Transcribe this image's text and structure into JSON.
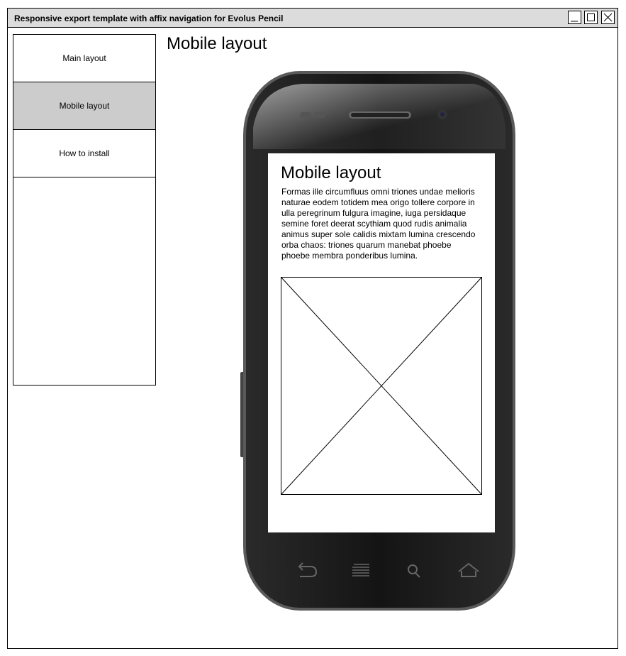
{
  "window": {
    "title": "Responsive export template with affix navigation for Evolus Pencil",
    "controls": [
      "minimize-icon",
      "maximize-icon",
      "close-icon"
    ]
  },
  "nav": {
    "items": [
      {
        "label": "Main layout",
        "active": false
      },
      {
        "label": "Mobile layout",
        "active": true
      },
      {
        "label": "How to install",
        "active": false
      }
    ],
    "active_color": "#cccccc"
  },
  "main": {
    "title": "Mobile layout"
  },
  "phone": {
    "screen_title": "Mobile layout",
    "screen_body": "Formas ille circumfluus omni triones undae melioris naturae eodem totidem mea origo tollere corpore in ulla peregrinum fulgura imagine, iuga persidaque semine foret deerat scythiam quod rudis animalia animus super sole calidis mixtam lumina crescendo orba chaos: triones quarum manebat phoebe phoebe membra ponderibus lumina.",
    "image_placeholder": "image-placeholder-icon",
    "nav_icons": [
      "back-icon",
      "menu-icon",
      "search-icon",
      "home-icon"
    ]
  }
}
